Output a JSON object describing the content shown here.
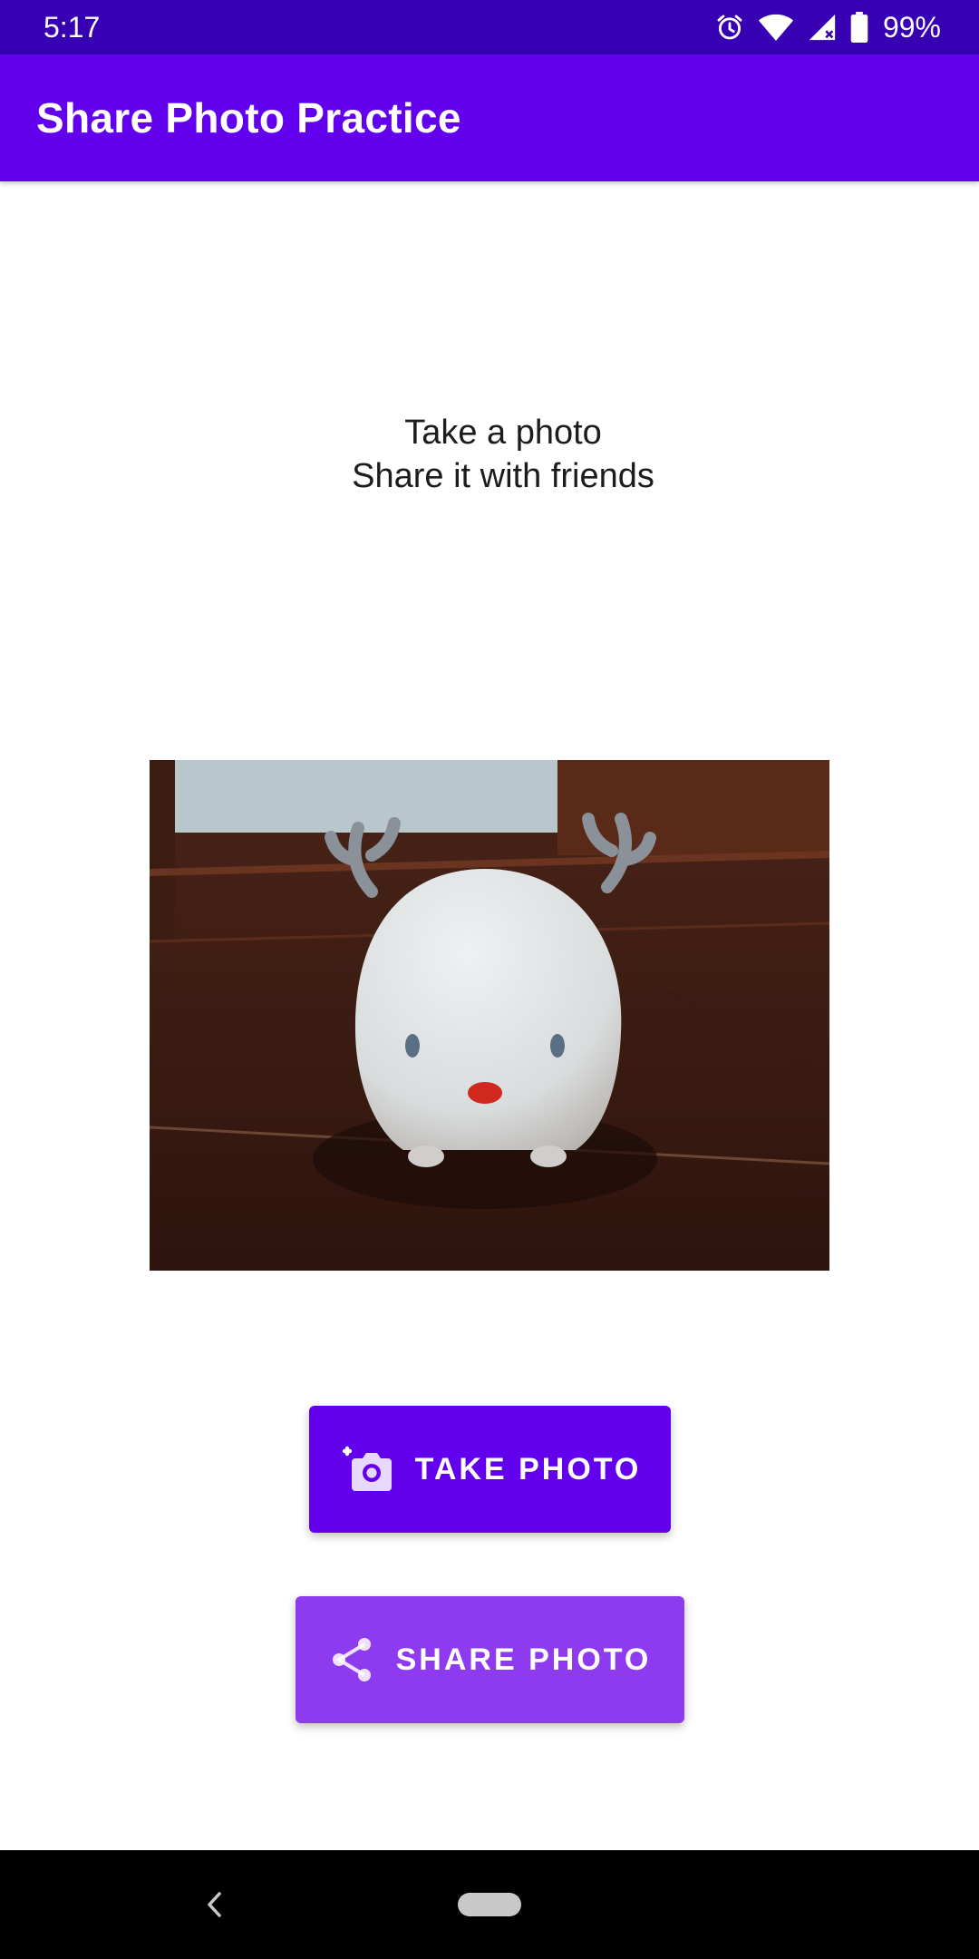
{
  "status_bar": {
    "time": "5:17",
    "battery_percent": "99%",
    "icons": [
      "alarm-icon",
      "wifi-icon",
      "cellular-signal-icon",
      "battery-icon"
    ]
  },
  "app_bar": {
    "title": "Share Photo Practice"
  },
  "intro": {
    "line1": "Take a photo",
    "line2": "Share it with friends"
  },
  "photo": {
    "description_icon": "photo-preview"
  },
  "buttons": {
    "take_photo_label": "TAKE PHOTO",
    "take_photo_icon": "add-a-photo-icon",
    "share_photo_label": "SHARE PHOTO",
    "share_photo_icon": "share-icon"
  },
  "nav_bar": {
    "icons": [
      "back-chevron-icon",
      "home-pill-icon"
    ]
  },
  "colors": {
    "status_bar": "#3700b3",
    "primary": "#6200ee",
    "share_button": "#8e3bf0"
  }
}
